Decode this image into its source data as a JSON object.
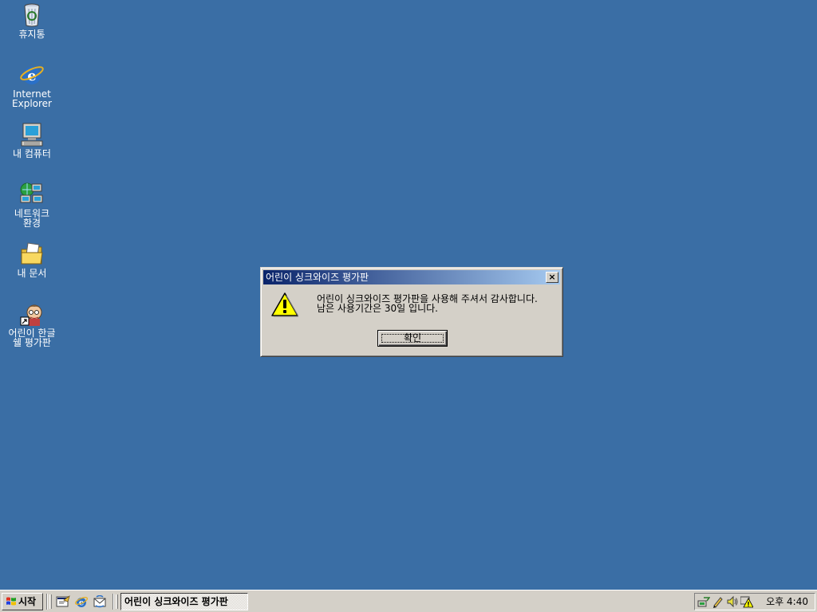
{
  "desktop": {
    "icons": [
      {
        "label": "휴지통",
        "icon": "recycle-bin-icon"
      },
      {
        "label": "Internet\nExplorer",
        "icon": "internet-explorer-icon"
      },
      {
        "label": "내 컴퓨터",
        "icon": "my-computer-icon"
      },
      {
        "label": "네트워크\n환경",
        "icon": "network-neighborhood-icon"
      },
      {
        "label": "내 문서",
        "icon": "my-documents-icon"
      },
      {
        "label": "어린이 한글\n쉘 평가판",
        "icon": "shell-trial-shortcut-icon"
      }
    ]
  },
  "dialog": {
    "title": "어린이 싱크와이즈 평가판",
    "close_label": "×",
    "message_line1": "어린이 싱크와이즈 평가판을 사용해 주셔서 감사합니다.",
    "message_line2": "남은 사용기간은 30일 입니다.",
    "ok_label": "확인",
    "icon": "warning-icon"
  },
  "taskbar": {
    "start_label": "시작",
    "quick_launch": [
      "show-desktop-icon",
      "internet-explorer-icon",
      "outlook-express-icon"
    ],
    "active_task": "어린이 싱크와이즈 평가판",
    "clock": "오후 4:40",
    "tray_icons": [
      "network-tray-icon",
      "pen-tray-icon",
      "volume-icon",
      "warning-tray-icon"
    ]
  },
  "colors": {
    "desktop": "#3a6ea5",
    "face": "#d4d0c8",
    "title_start": "#0a246a",
    "title_end": "#a6caf0"
  }
}
